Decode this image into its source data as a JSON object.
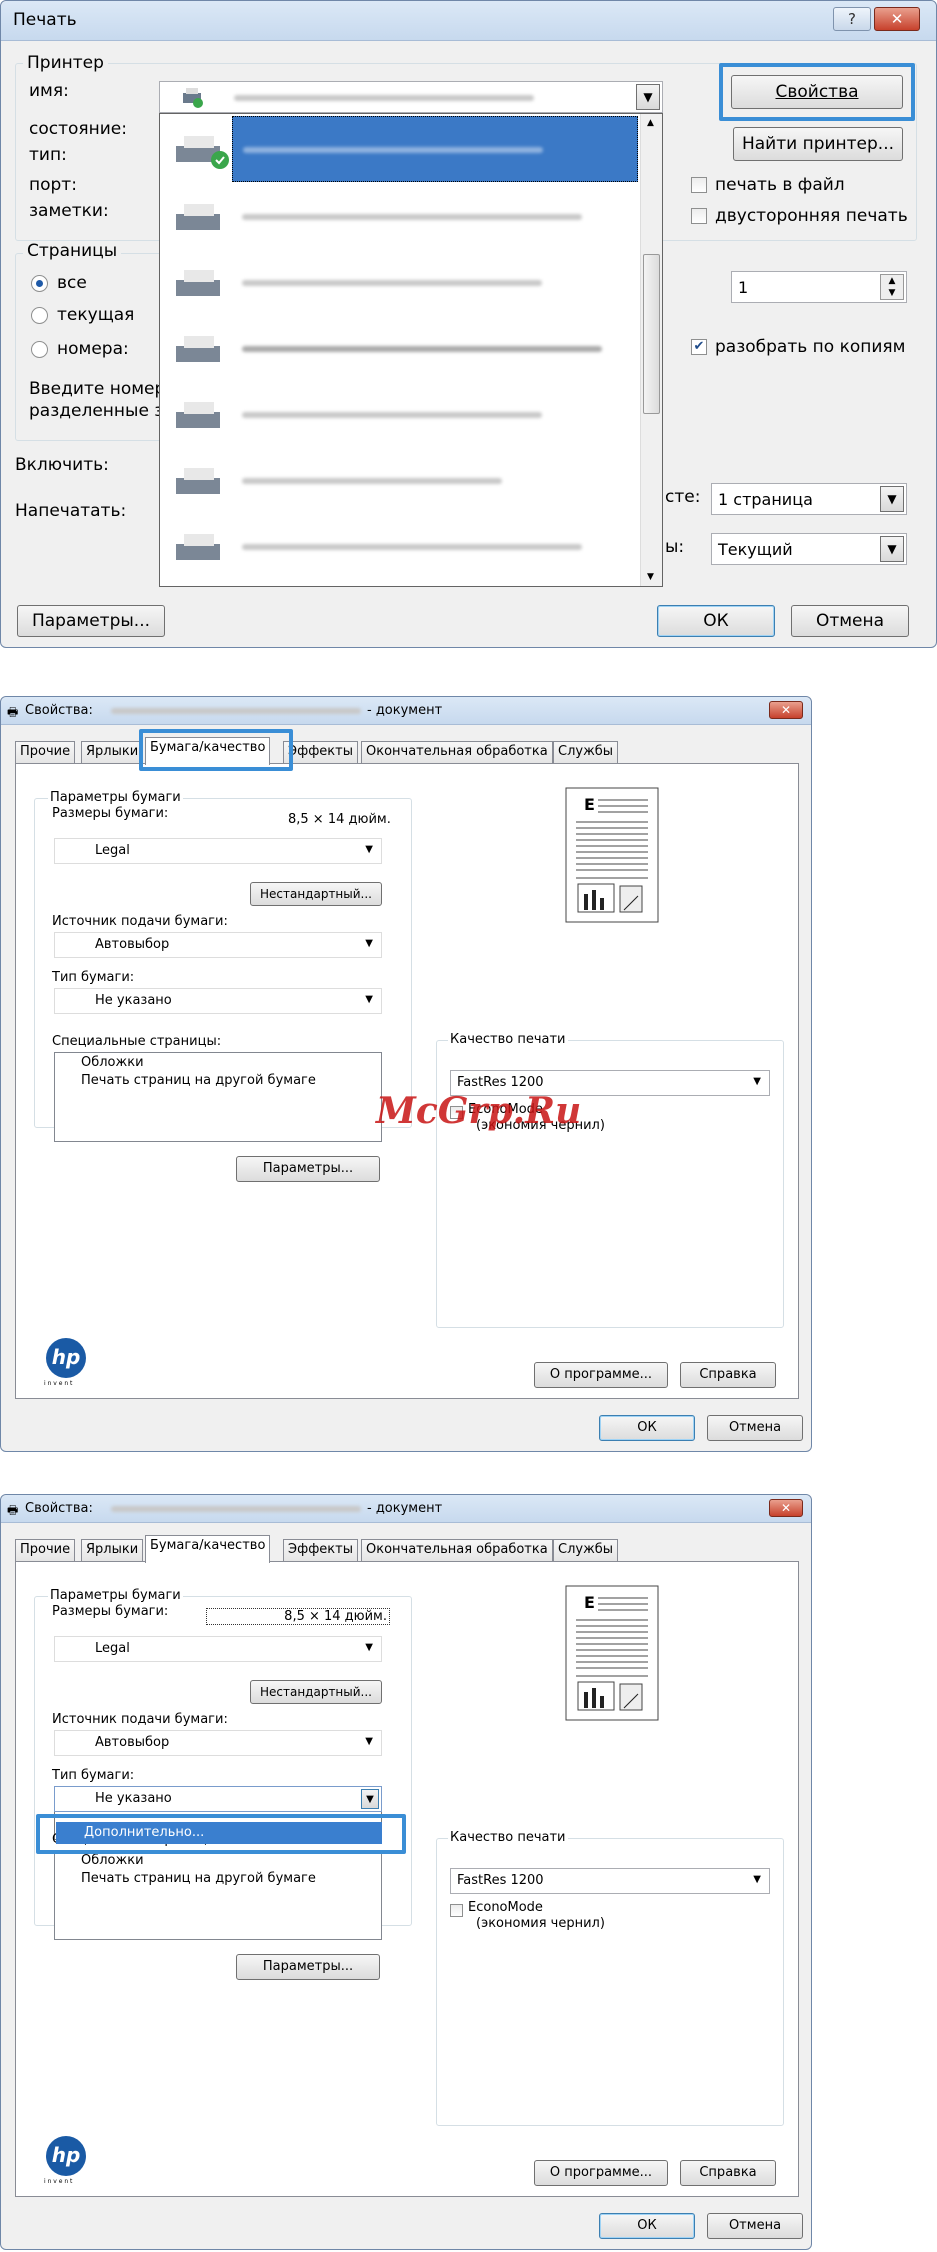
{
  "print_dialog": {
    "title": "Печать",
    "help_label": "?",
    "close_label": "✕",
    "printer_group": "Принтер",
    "name_label": "имя:",
    "status_label": "состояние:",
    "type_label": "тип:",
    "port_label": "порт:",
    "comments_label": "заметки:",
    "properties_button": "Свойства",
    "find_printer_button": "Найти принтер...",
    "print_to_file": "печать в файл",
    "duplex": "двусторонняя печать",
    "pages_group": "Страницы",
    "all": "все",
    "current": "текущая",
    "pages": "номера:",
    "hint_line1": "Введите номера",
    "hint_line2": "разделенные з",
    "copies_value": "1",
    "collate": "разобрать по копиям",
    "include_label": "Включить:",
    "print_label": "Напечатать:",
    "scale_label_suffix": "сте:",
    "zoom_suffix": "ы:",
    "per_page_value": "1 страница",
    "scale_value": "Текущий",
    "params_button": "Параметры...",
    "ok_button": "ОК",
    "cancel_button": "Отмена"
  },
  "properties": {
    "title_prefix": "Свойства:",
    "title_suffix": "- документ",
    "tabs": [
      "Прочие",
      "Ярлыки",
      "Бумага/качество",
      "Эффекты",
      "Окончательная обработка",
      "Службы"
    ],
    "paper_params": "Параметры бумаги",
    "paper_sizes": "Размеры бумаги:",
    "size_value": "8,5 × 14 дюйм.",
    "paper_value": "Legal",
    "custom_button": "Нестандартный...",
    "source_label": "Источник подачи бумаги:",
    "source_value": "Автовыбор",
    "type_label": "Тип бумаги:",
    "type_value": "Не указано",
    "special_pages": "Специальные страницы:",
    "special_items": [
      "Обложки",
      "Печать страниц на другой бумаге"
    ],
    "params_button": "Параметры...",
    "quality_label": "Качество печати",
    "quality_value": "FastRes 1200",
    "economode": "EconoMode",
    "economode_sub": "(экономия чернил)",
    "about_button": "О программе...",
    "help_button": "Справка",
    "ok_button": "ОК",
    "cancel_button": "Отмена",
    "hp_label": "hp",
    "invent_label": "i n v e n t",
    "dropdown_option": "Дополнительно..."
  },
  "watermark": "McGrp.Ru"
}
